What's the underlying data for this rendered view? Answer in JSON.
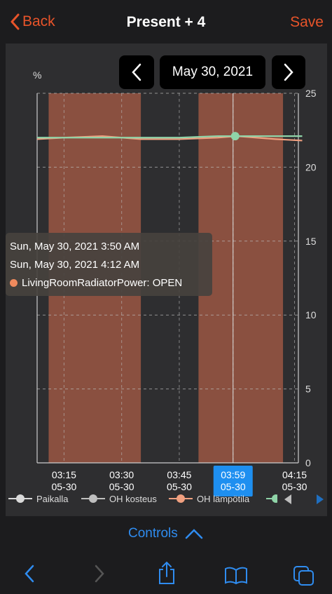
{
  "nav": {
    "back_label": "Back",
    "title": "Present + 4",
    "save_label": "Save"
  },
  "date_picker": {
    "date": "May 30, 2021"
  },
  "chart_data": {
    "type": "line",
    "ylabel": "%",
    "y_right_ticks": [
      "0",
      "5",
      "10",
      "15",
      "20",
      "25"
    ],
    "ylim": [
      0,
      25
    ],
    "x_ticks": [
      {
        "time": "03:15",
        "date": "05-30"
      },
      {
        "time": "03:30",
        "date": "05-30"
      },
      {
        "time": "03:45",
        "date": "05-30"
      },
      {
        "time": "03:59",
        "date": "05-30",
        "highlighted": true
      },
      {
        "time": "04:15",
        "date": "05-30"
      }
    ],
    "xlim_minutes": [
      3.2,
      4.27
    ],
    "open_periods": [
      {
        "start": "03:11",
        "end": "03:35"
      },
      {
        "start": "03:50",
        "end": "04:12"
      }
    ],
    "series": [
      {
        "name": "OH lämpötila",
        "color": "#f0a080",
        "x": [
          "03:08",
          "03:15",
          "03:25",
          "03:35",
          "03:45",
          "03:55",
          "04:00",
          "04:10",
          "04:17"
        ],
        "y": [
          21.9,
          22.0,
          22.1,
          21.9,
          21.9,
          22.0,
          22.1,
          21.9,
          21.8
        ]
      },
      {
        "name": "",
        "color": "#8fd4a8",
        "x": [
          "03:08",
          "03:15",
          "03:25",
          "03:35",
          "03:45",
          "03:55",
          "04:00",
          "04:10",
          "04:17"
        ],
        "y": [
          22.0,
          22.0,
          22.0,
          22.0,
          22.0,
          22.1,
          22.1,
          22.1,
          22.1
        ]
      }
    ],
    "cursor": {
      "time": "03:59",
      "value": 22.1
    },
    "grid": true,
    "colors": {
      "open_band": "#8a5040",
      "grid": "#bbbbbb",
      "axis": "#cccccc",
      "highlight": "#1e8ff0"
    }
  },
  "tooltip": {
    "line1": "Sun, May 30, 2021 3:50 AM",
    "line2": "Sun, May 30, 2021 4:12 AM",
    "line3": "LivingRoomRadiatorPower: OPEN"
  },
  "legend": [
    {
      "label": "Paikalla",
      "icon": "line-circle-icon",
      "color": "#d9d9d9"
    },
    {
      "label": "OH kosteus",
      "icon": "line-circle-icon",
      "color": "#bfbfbf"
    },
    {
      "label": "OH lämpötila",
      "icon": "line-circle-icon",
      "color": "#f0a080"
    }
  ],
  "controls": {
    "label": "Controls"
  }
}
